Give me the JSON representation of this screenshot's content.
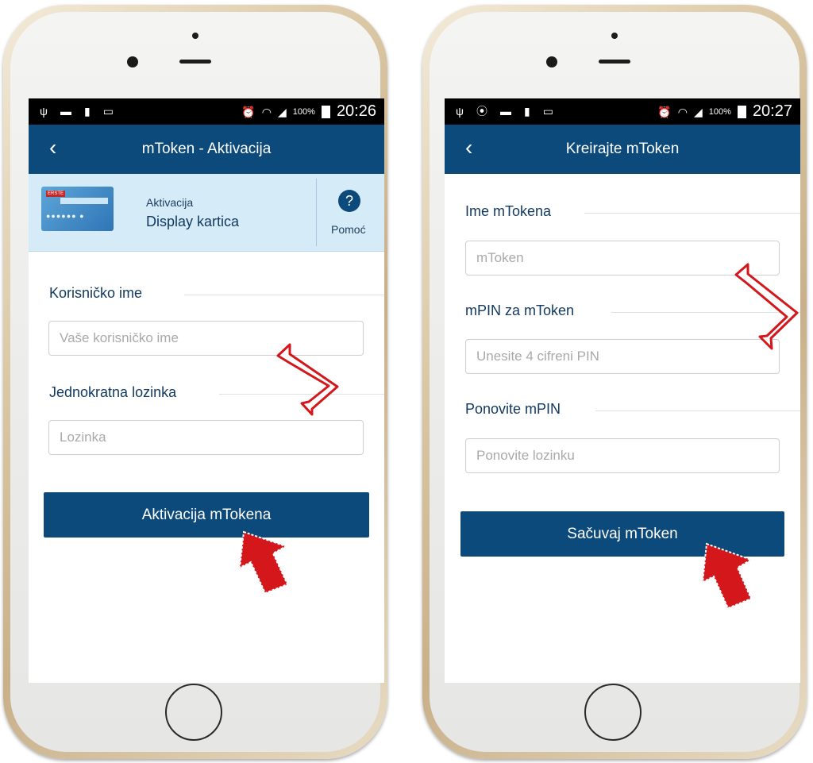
{
  "left_phone": {
    "status": {
      "time": "20:26",
      "battery_pct": "100%"
    },
    "header": {
      "back_icon": "chevron-left-icon",
      "title": "mToken - Aktivacija"
    },
    "info": {
      "line1": "Aktivacija",
      "line2": "Display kartica",
      "card_logo": "ERSTE",
      "help_glyph": "?",
      "help_label": "Pomoć"
    },
    "fields": [
      {
        "label": "Korisničko ime",
        "placeholder": "Vaše korisničko ime",
        "value": ""
      },
      {
        "label": "Jednokratna lozinka",
        "placeholder": "Lozinka",
        "value": ""
      }
    ],
    "button": "Aktivacija mTokena"
  },
  "right_phone": {
    "status": {
      "time": "20:27",
      "battery_pct": "100%"
    },
    "header": {
      "back_icon": "chevron-left-icon",
      "title": "Kreirajte mToken"
    },
    "fields": [
      {
        "label": "Ime mTokena",
        "placeholder": "mToken",
        "value": ""
      },
      {
        "label": "mPIN za mToken",
        "placeholder": "Unesite 4 cifreni PIN",
        "value": ""
      },
      {
        "label": "Ponovite mPIN",
        "placeholder": "Ponovite lozinku",
        "value": ""
      }
    ],
    "button": "Sačuvaj mToken"
  },
  "colors": {
    "primary": "#0d4a7c",
    "subheader_bg": "#d6ebf8",
    "annotation_red": "#d3171b"
  },
  "annotations": {
    "icons": [
      "double-arrow-icon",
      "arrow-up-icon"
    ]
  }
}
